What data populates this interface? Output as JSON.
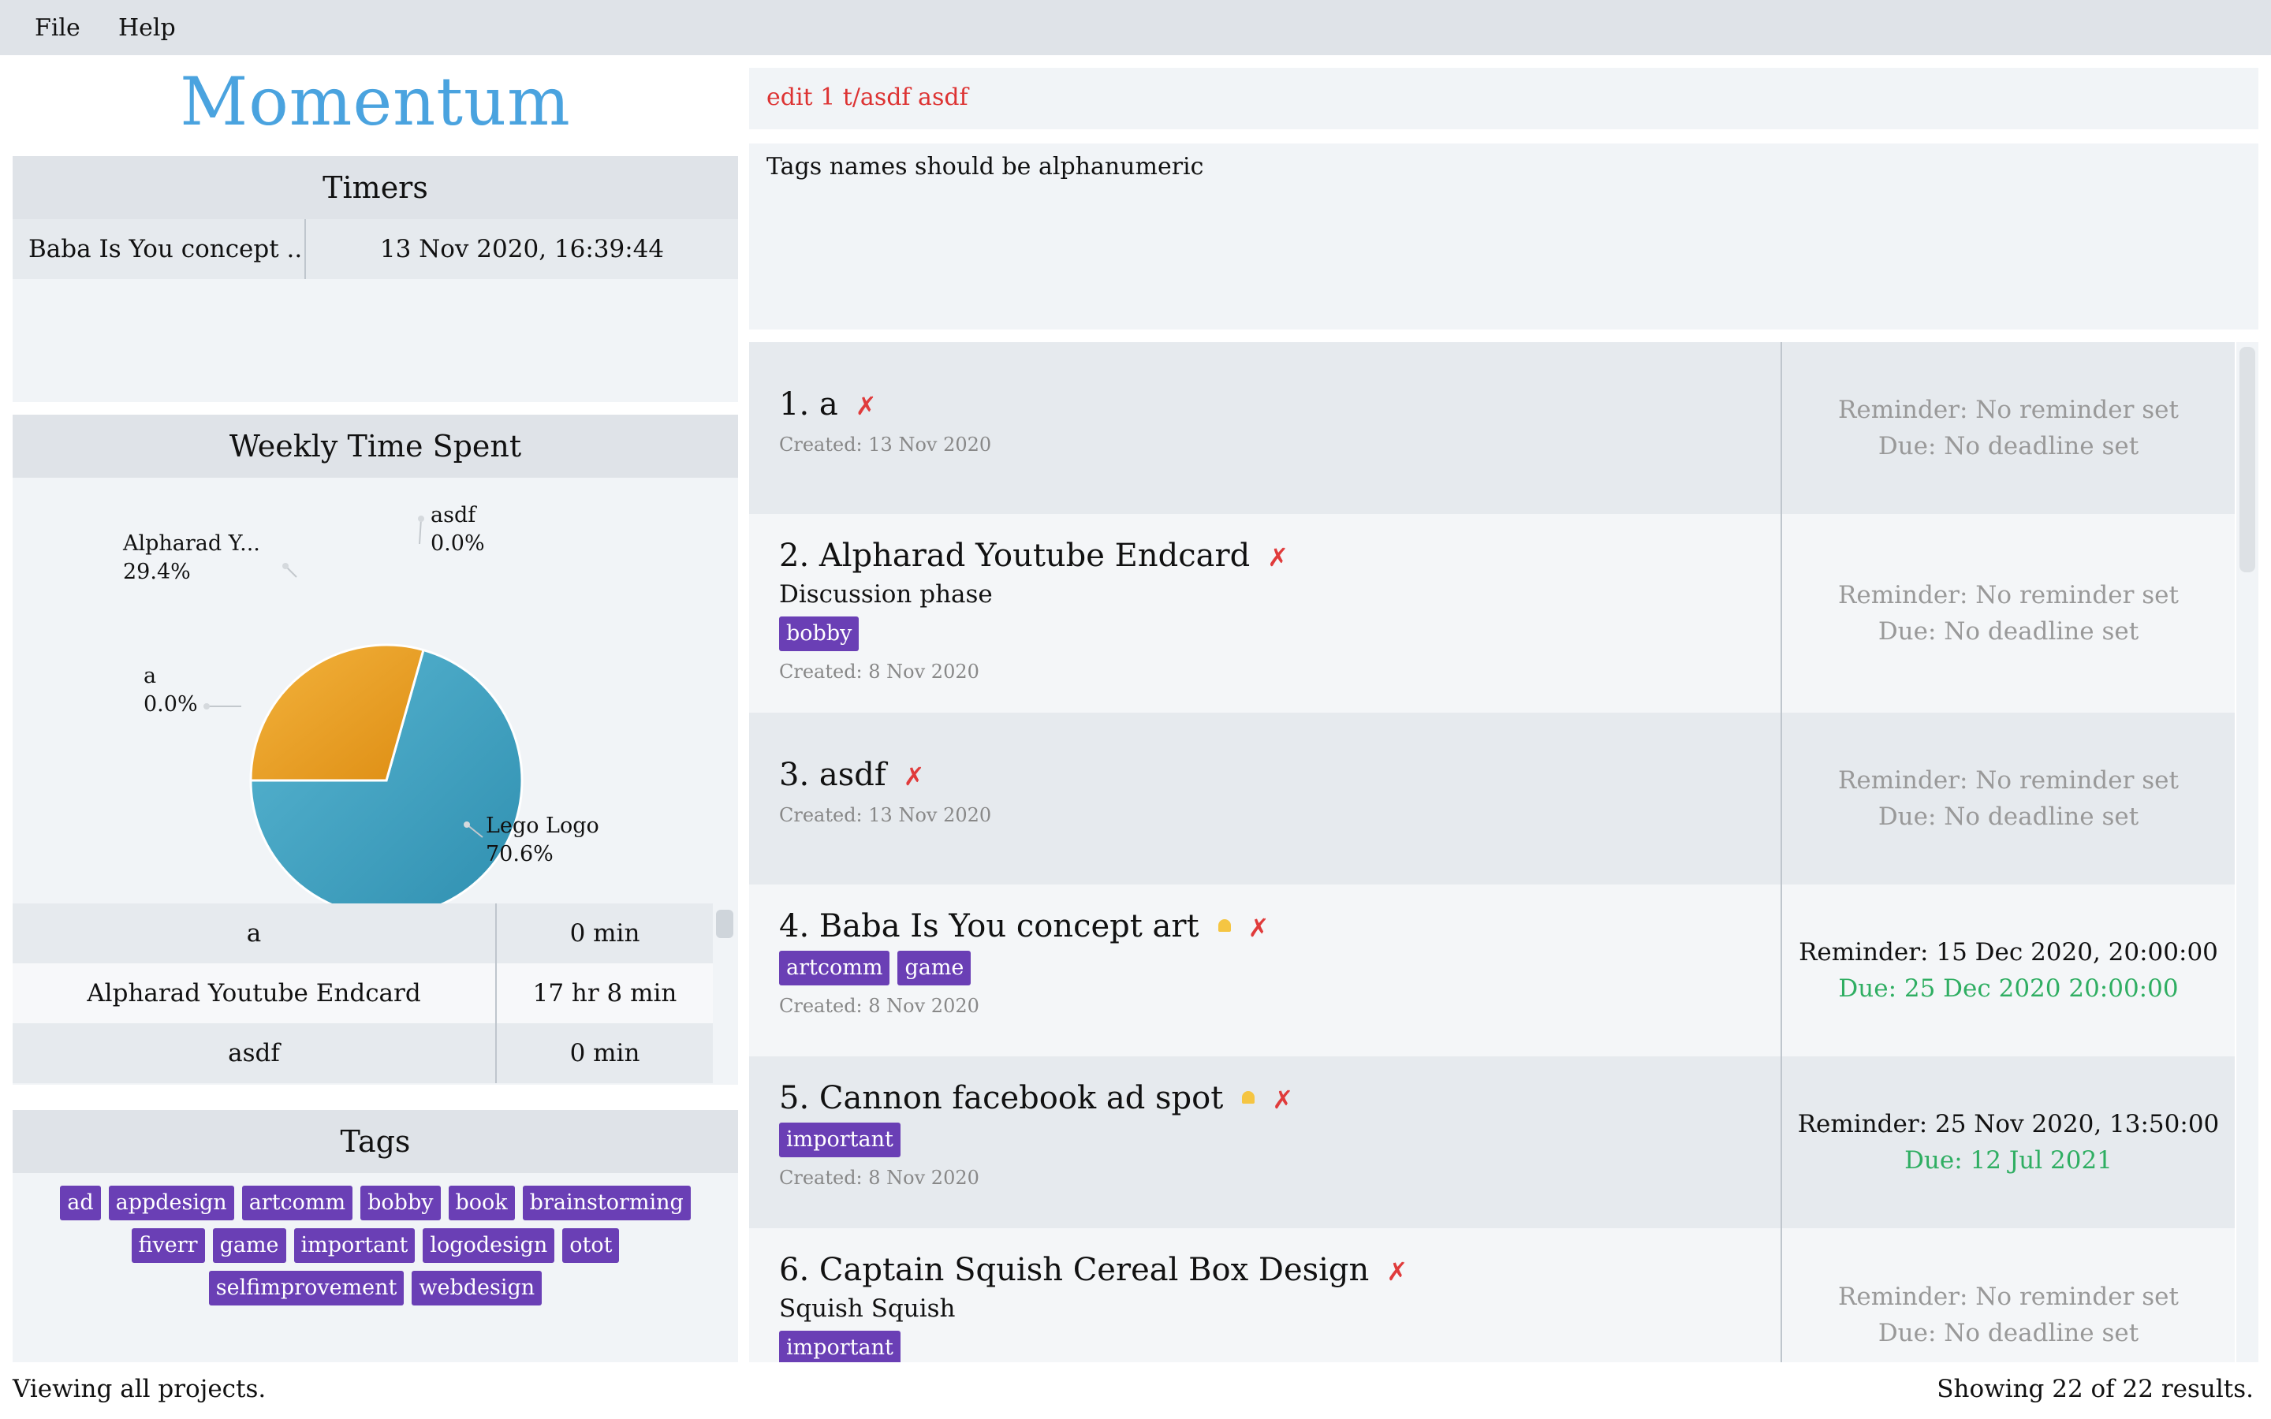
{
  "menu": {
    "file": "File",
    "help": "Help"
  },
  "app_title": "Momentum",
  "timers": {
    "header": "Timers",
    "rows": [
      {
        "name": "Baba Is You concept ...",
        "time": "13 Nov 2020, 16:39:44"
      }
    ]
  },
  "weekly": {
    "header": "Weekly Time Spent",
    "pie": [
      {
        "label": "Alpharad Y...",
        "percent_text": "29.4%",
        "value": 29.4,
        "color": "#f0a92b"
      },
      {
        "label": "asdf",
        "percent_text": "0.0%",
        "value": 0.0,
        "color": "#f0a92b"
      },
      {
        "label": "a",
        "percent_text": "0.0%",
        "value": 0.0,
        "color": "#f0a92b"
      },
      {
        "label": "Lego Logo",
        "percent_text": "70.6%",
        "value": 70.6,
        "color": "#3a9bbd"
      }
    ],
    "rows": [
      {
        "name": "a",
        "value": "0 min"
      },
      {
        "name": "Alpharad Youtube Endcard",
        "value": "17 hr 8 min"
      },
      {
        "name": "asdf",
        "value": "0 min"
      }
    ]
  },
  "tags_panel": {
    "header": "Tags",
    "tags": [
      "ad",
      "appdesign",
      "artcomm",
      "bobby",
      "book",
      "brainstorming",
      "fiverr",
      "game",
      "important",
      "logodesign",
      "otot",
      "selfimprovement",
      "webdesign"
    ]
  },
  "command": {
    "text": "edit 1 t/asdf asdf",
    "color": "#d33333"
  },
  "result": {
    "text": "Tags names should be alphanumeric"
  },
  "projects": [
    {
      "title": "1. a",
      "description": "",
      "tags": [],
      "created": "Created: 13 Nov 2020",
      "reminder": "Reminder: No reminder set",
      "due": "Due: No deadline set",
      "has_bell": false,
      "reminder_active": false,
      "due_status": "none"
    },
    {
      "title": "2. Alpharad Youtube Endcard",
      "description": "Discussion phase",
      "tags": [
        "bobby"
      ],
      "created": "Created: 8 Nov 2020",
      "reminder": "Reminder: No reminder set",
      "due": "Due: No deadline set",
      "has_bell": false,
      "reminder_active": false,
      "due_status": "none"
    },
    {
      "title": "3. asdf",
      "description": "",
      "tags": [],
      "created": "Created: 13 Nov 2020",
      "reminder": "Reminder: No reminder set",
      "due": "Due: No deadline set",
      "has_bell": false,
      "reminder_active": false,
      "due_status": "none"
    },
    {
      "title": "4. Baba Is You concept art",
      "description": "",
      "tags": [
        "artcomm",
        "game"
      ],
      "created": "Created: 8 Nov 2020",
      "reminder": "Reminder: 15 Dec 2020, 20:00:00",
      "due": "Due: 25 Dec 2020 20:00:00",
      "has_bell": true,
      "reminder_active": true,
      "due_status": "upcoming"
    },
    {
      "title": "5. Cannon facebook ad spot",
      "description": "",
      "tags": [
        "important"
      ],
      "created": "Created: 8 Nov 2020",
      "reminder": "Reminder: 25 Nov 2020, 13:50:00",
      "due": "Due: 12 Jul 2021",
      "has_bell": true,
      "reminder_active": true,
      "due_status": "upcoming"
    },
    {
      "title": "6. Captain Squish Cereal Box Design",
      "description": "Squish Squish",
      "tags": [
        "important"
      ],
      "created": "",
      "reminder": "Reminder: No reminder set",
      "due": "Due: No deadline set",
      "has_bell": false,
      "reminder_active": false,
      "due_status": "none"
    }
  ],
  "status": {
    "left": "Viewing all projects.",
    "right": "Showing 22 of 22 results."
  },
  "icons": {
    "delete": "cross-mark-icon",
    "reminder": "bell-icon"
  },
  "colors": {
    "accent": "#4aa3df",
    "tag": "#6a3fb5",
    "due_green": "#2fae62",
    "error": "#d33333"
  }
}
